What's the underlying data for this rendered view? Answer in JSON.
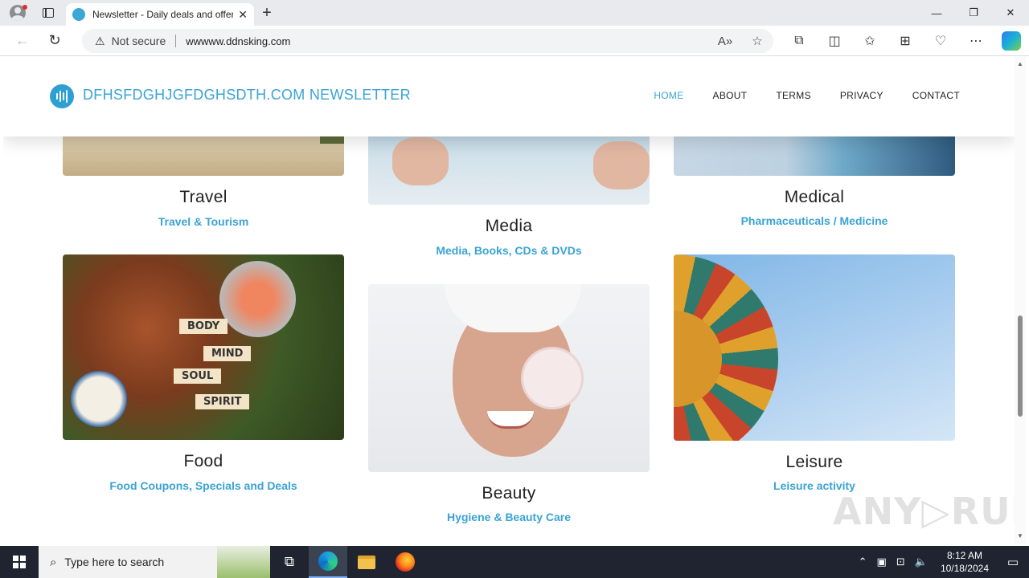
{
  "browser": {
    "tab_title": "Newsletter - Daily deals and offers",
    "tab_close": "✕",
    "new_tab": "+",
    "security_label": "Not secure",
    "url": "wwwww.ddnsking.com",
    "window_controls": {
      "minimize": "—",
      "restore": "❐",
      "close": "✕"
    }
  },
  "site": {
    "logo_text": "DFHSFDGHJGFDGHSDTH.COM  NEWSLETTER",
    "nav": [
      {
        "label": "HOME",
        "active": true
      },
      {
        "label": "ABOUT"
      },
      {
        "label": "TERMS"
      },
      {
        "label": "PRIVACY"
      },
      {
        "label": "CONTACT"
      }
    ],
    "categories": [
      {
        "title": "Travel",
        "subtitle": "Travel & Tourism"
      },
      {
        "title": "Media",
        "subtitle": "Media, Books, CDs & DVDs"
      },
      {
        "title": "Medical",
        "subtitle": "Pharmaceuticals / Medicine"
      },
      {
        "title": "Food",
        "subtitle": "Food Coupons, Specials and Deals",
        "image_signs": [
          "BODY",
          "MIND",
          "SOUL",
          "SPIRIT"
        ]
      },
      {
        "title": "Beauty",
        "subtitle": "Hygiene & Beauty Care"
      },
      {
        "title": "Leisure",
        "subtitle": "Leisure activity"
      }
    ],
    "watermark": "ANY▷RUN"
  },
  "taskbar": {
    "search_placeholder": "Type here to search",
    "time": "8:12 AM",
    "date": "10/18/2024"
  },
  "colors": {
    "accent": "#3aa3d4",
    "taskbar": "#1f2430"
  }
}
